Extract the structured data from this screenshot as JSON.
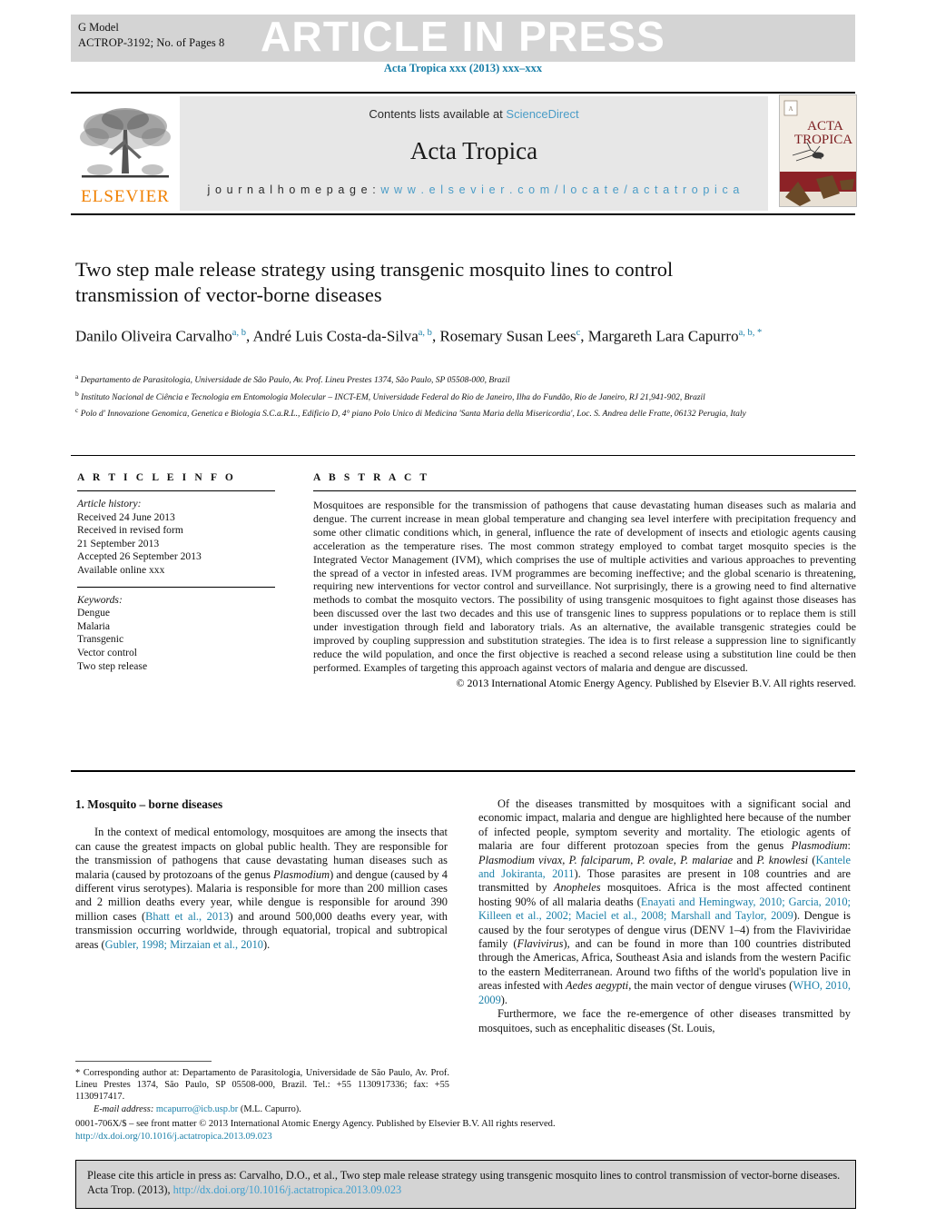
{
  "header": {
    "g_model": "G Model",
    "article_id": "ACTROP-3192;   No. of Pages 8",
    "article_in_press": "ARTICLE IN PRESS",
    "journal_ref": "Acta Tropica xxx (2013) xxx–xxx"
  },
  "masthead": {
    "contents_prefix": "Contents lists available at ",
    "sciencedirect": "ScienceDirect",
    "journal_title": "Acta Tropica",
    "homepage_label": "j o u r n a l   h o m e p a g e :   ",
    "homepage_url": "w w w . e l s e v i e r . c o m / l o c a t e / a c t a t r o p i c a",
    "publisher_logo_text": "ELSEVIER",
    "cover_title_line1": "ACTA",
    "cover_title_line2": "TROPICA"
  },
  "article": {
    "title": "Two step male release strategy using transgenic mosquito lines to control transmission of vector-borne diseases",
    "authors_html": "Danilo Oliveira Carvalho<sup>a, b</sup>, André Luis Costa-da-Silva<sup>a, b</sup>, Rosemary Susan Lees<sup>c</sup>, Margareth Lara Capurro<sup>a, b, *</sup>",
    "affiliations": [
      "Departamento de Parasitologia, Universidade de São Paulo, Av. Prof. Lineu Prestes 1374, São Paulo, SP 05508-000, Brazil",
      "Instituto Nacional de Ciência e Tecnologia em Entomologia Molecular – INCT-EM, Universidade Federal do Rio de Janeiro, Ilha do Fundão, Rio de Janeiro, RJ 21,941-902, Brazil",
      "Polo d' Innovazione Genomica, Genetica e Biologia S.C.a.R.L., Edificio D, 4° piano Polo Unico di Medicina 'Santa Maria della Misericordia', Loc. S. Andrea delle Fratte, 06132 Perugia, Italy"
    ],
    "affiliation_markers": [
      "a",
      "b",
      "c"
    ]
  },
  "article_info": {
    "heading": "A R T I C L E   I N F O",
    "history_label": "Article history:",
    "history": [
      "Received 24 June 2013",
      "Received in revised form",
      "21 September 2013",
      "Accepted 26 September 2013",
      "Available online xxx"
    ],
    "keywords_label": "Keywords:",
    "keywords": [
      "Dengue",
      "Malaria",
      "Transgenic",
      "Vector control",
      "Two step release"
    ]
  },
  "abstract": {
    "heading": "A B S T R A C T",
    "text": "Mosquitoes are responsible for the transmission of pathogens that cause devastating human diseases such as malaria and dengue. The current increase in mean global temperature and changing sea level interfere with precipitation frequency and some other climatic conditions which, in general, influence the rate of development of insects and etiologic agents causing acceleration as the temperature rises. The most common strategy employed to combat target mosquito species is the Integrated Vector Management (IVM), which comprises the use of multiple activities and various approaches to preventing the spread of a vector in infested areas. IVM programmes are becoming ineffective; and the global scenario is threatening, requiring new interventions for vector control and surveillance. Not surprisingly, there is a growing need to find alternative methods to combat the mosquito vectors. The possibility of using transgenic mosquitoes to fight against those diseases has been discussed over the last two decades and this use of transgenic lines to suppress populations or to replace them is still under investigation through field and laboratory trials. As an alternative, the available transgenic strategies could be improved by coupling suppression and substitution strategies. The idea is to first release a suppression line to significantly reduce the wild population, and once the first objective is reached a second release using a substitution line could be then performed. Examples of targeting this approach against vectors of malaria and dengue are discussed.",
    "copyright": "© 2013 International Atomic Energy Agency. Published by Elsevier B.V. All rights reserved."
  },
  "body": {
    "section_title": "1.  Mosquito – borne diseases",
    "left_paragraphs": [
      {
        "segments": [
          {
            "t": "In the context of medical entomology, mosquitoes are among the insects that can cause the greatest impacts on global public health. They are responsible for the transmission of pathogens that cause devastating human diseases such as malaria (caused by protozoans of the genus ",
            "s": "plain"
          },
          {
            "t": "Plasmodium",
            "s": "italic"
          },
          {
            "t": ") and dengue (caused by 4 different virus serotypes). Malaria is responsible for more than 200 million cases and 2 million deaths every year, while dengue is responsible for around 390 million cases (",
            "s": "plain"
          },
          {
            "t": "Bhatt et al., 2013",
            "s": "ref"
          },
          {
            "t": ") and around 500,000 deaths every year, with transmission occurring worldwide, through equatorial, tropical and subtropical areas (",
            "s": "plain"
          },
          {
            "t": "Gubler, 1998; Mirzaian et al., 2010",
            "s": "ref"
          },
          {
            "t": ").",
            "s": "plain"
          }
        ]
      }
    ],
    "right_paragraphs": [
      {
        "segments": [
          {
            "t": "Of the diseases transmitted by mosquitoes with a significant social and economic impact, malaria and dengue are highlighted here because of the number of infected people, symptom severity and mortality. The etiologic agents of malaria are four different protozoan species from the genus ",
            "s": "plain"
          },
          {
            "t": "Plasmodium",
            "s": "italic"
          },
          {
            "t": ": ",
            "s": "plain"
          },
          {
            "t": "Plasmodium vivax, P. falciparum, P. ovale, P. malariae",
            "s": "italic"
          },
          {
            "t": " and ",
            "s": "plain"
          },
          {
            "t": "P. knowlesi",
            "s": "italic"
          },
          {
            "t": " (",
            "s": "plain"
          },
          {
            "t": "Kantele and Jokiranta, 2011",
            "s": "ref"
          },
          {
            "t": "). Those parasites are present in 108 countries and are transmitted by ",
            "s": "plain"
          },
          {
            "t": "Anopheles",
            "s": "italic"
          },
          {
            "t": " mosquitoes. Africa is the most affected continent hosting 90% of all malaria deaths (",
            "s": "plain"
          },
          {
            "t": "Enayati and Hemingway, 2010; Garcia, 2010; Killeen et al., 2002; Maciel et al., 2008; Marshall and Taylor, 2009",
            "s": "ref"
          },
          {
            "t": "). Dengue is caused by the four serotypes of dengue virus (DENV 1–4) from the Flaviviridae family (",
            "s": "plain"
          },
          {
            "t": "Flavivirus",
            "s": "italic"
          },
          {
            "t": "), and can be found in more than 100 countries distributed through the Americas, Africa, Southeast Asia and islands from the western Pacific to the eastern Mediterranean. Around two fifths of the world's population live in areas infested with ",
            "s": "plain"
          },
          {
            "t": "Aedes aegypti",
            "s": "italic"
          },
          {
            "t": ", the main vector of dengue viruses (",
            "s": "plain"
          },
          {
            "t": "WHO, 2010, 2009",
            "s": "ref"
          },
          {
            "t": ").",
            "s": "plain"
          }
        ]
      },
      {
        "segments": [
          {
            "t": "Furthermore, we face the re-emergence of other diseases transmitted by mosquitoes, such as encephalitic diseases (St. Louis,",
            "s": "plain"
          }
        ]
      }
    ]
  },
  "footnote": {
    "marker": "*",
    "corresponding": "Corresponding author at: Departamento de Parasitologia, Universidade de São Paulo, Av. Prof. Lineu Prestes 1374, São Paulo, SP 05508-000, Brazil.",
    "tel": "Tel.: +55 1130917336; fax: +55 1130917417.",
    "email_label": "E-mail address:",
    "email": "mcapurro@icb.usp.br",
    "email_suffix": "(M.L. Capurro)."
  },
  "issn": {
    "line1": "0001-706X/$ – see front matter © 2013 International Atomic Energy Agency. Published by Elsevier B.V. All rights reserved.",
    "doi": "http://dx.doi.org/10.1016/j.actatropica.2013.09.023"
  },
  "cite_box": {
    "text": "Please cite this article in press as: Carvalho, D.O., et al., Two step male release strategy using transgenic mosquito lines to control transmission of vector-borne diseases. Acta Trop. (2013), ",
    "doi": "http://dx.doi.org/10.1016/j.actatropica.2013.09.023"
  },
  "colors": {
    "link": "#1a7fa8",
    "banner_gray": "#d4d4d4",
    "masthead_gray": "#e7e7e7",
    "elsevier_orange": "#f08000"
  }
}
